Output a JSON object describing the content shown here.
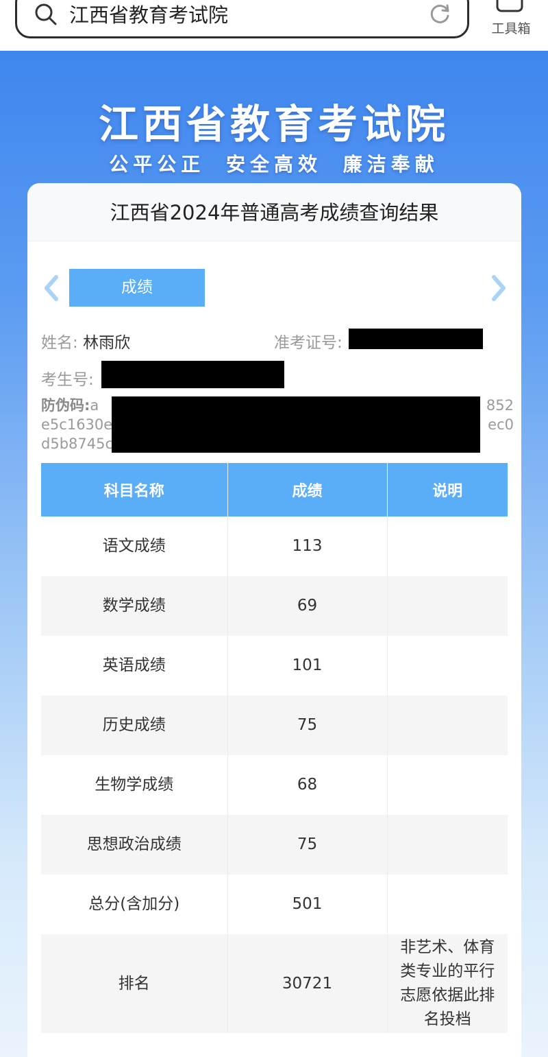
{
  "browser": {
    "search_text": "江西省教育考试院",
    "toolbox_label": "工具箱"
  },
  "hero": {
    "title": "江西省教育考试院",
    "slogan": "公平公正 安全高效 廉洁奉献"
  },
  "card": {
    "title": "江西省2024年普通高考成绩查询结果",
    "tab_label": "成绩",
    "name_label": "姓名:",
    "name_value": "林雨欣",
    "admission_label": "准考证号:",
    "examinee_label": "考生号:",
    "anti_fake_label": "防伪码:",
    "anti_fake_lines": [
      "a",
      "852",
      "e5c1630e",
      "ec0",
      "d5b8745c"
    ]
  },
  "table": {
    "headers": [
      "科目名称",
      "成绩",
      "说明"
    ],
    "rows": [
      {
        "subject": "语文成绩",
        "score": "113",
        "note": ""
      },
      {
        "subject": "数学成绩",
        "score": "69",
        "note": ""
      },
      {
        "subject": "英语成绩",
        "score": "101",
        "note": ""
      },
      {
        "subject": "历史成绩",
        "score": "75",
        "note": ""
      },
      {
        "subject": "生物学成绩",
        "score": "68",
        "note": ""
      },
      {
        "subject": "思想政治成绩",
        "score": "75",
        "note": ""
      },
      {
        "subject": "总分(含加分)",
        "score": "501",
        "note": ""
      },
      {
        "subject": "排名",
        "score": "30721",
        "note": "非艺术、体育类专业的平行志愿依据此排名投档"
      }
    ]
  },
  "colors": {
    "accent": "#5aadf7",
    "hero_top": "#3f86ee",
    "redaction": "#000000"
  }
}
